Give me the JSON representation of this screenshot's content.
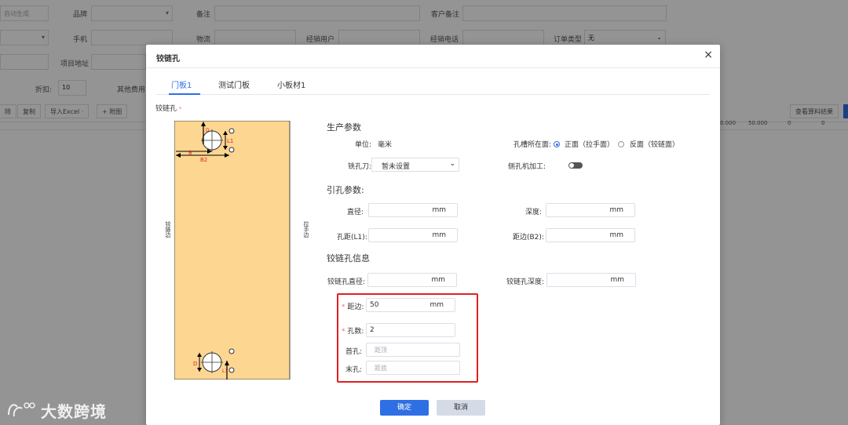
{
  "background": {
    "labels": {
      "auto_generate_ph": "自动生成",
      "brand": "品牌",
      "remark": "备注",
      "customer_remark": "客户备注",
      "phone": "手机",
      "logistics": "物流",
      "dealer_user": "经销用户",
      "dealer_phone": "经销电话",
      "order_type": "订单类型",
      "order_type_value": "无",
      "project_address": "项目地址",
      "discount": "折扣:",
      "discount_value": "10",
      "other_fees": "其他费用:"
    },
    "toolbar": {
      "delete": "除",
      "copy": "复制",
      "import_excel": "导入Excel ·",
      "attach": "+ 附图",
      "view_materials": "查看算料结果"
    },
    "table_snippets": {
      "a": "0.000",
      "b": "50.000",
      "c": "0",
      "d": "0"
    }
  },
  "dialog": {
    "title": "铰链孔",
    "close_glyph": "×",
    "tabs": [
      "门板1",
      "测试门板",
      "小板材1"
    ],
    "active_tab": 0,
    "section_label": "铰链孔",
    "section_star": "*",
    "diagram": {
      "left_side_label": "铰链边",
      "right_side_label": "拉手边",
      "top_labels": {
        "b": "B",
        "b2": "B2",
        "l1": "L1",
        "d": "D"
      },
      "bottom_labels": {
        "d": "D",
        "l1": "L1"
      }
    },
    "production": {
      "heading": "生产参数",
      "unit_label": "单位:",
      "unit_value": "毫米",
      "slot_face_label": "孔槽所在面:",
      "face_front": "正面（拉手面）",
      "face_back": "反面（铰链面）",
      "face_selected": "front",
      "cutter_label": "铣孔刀:",
      "cutter_value": "暂未设置",
      "side_machine_label": "侧孔机加工:",
      "side_machine_on": false
    },
    "pilot": {
      "heading": "引孔参数:",
      "diameter_label": "直径:",
      "depth_label": "深度:",
      "hole_distance_label": "孔距(L1):",
      "edge_distance_label": "距边(B2):",
      "unit": "mm"
    },
    "hinge_info": {
      "heading": "铰链孔信息",
      "diameter_label": "铰链孔直径:",
      "depth_label": "铰链孔深度:",
      "unit": "mm",
      "edge_label": "距边:",
      "edge_value": "50",
      "count_label": "孔数:",
      "count_value": "2",
      "first_label": "首孔:",
      "first_placeholder": "距顶",
      "last_label": "末孔:",
      "last_placeholder": "距底"
    },
    "buttons": {
      "ok": "确定",
      "cancel": "取消"
    }
  },
  "watermark": {
    "text": "大数跨境",
    "icon": "logo-icon"
  },
  "colors": {
    "accent": "#2f6fe4",
    "highlight": "#e02020",
    "panel_fill": "#fdd691"
  }
}
